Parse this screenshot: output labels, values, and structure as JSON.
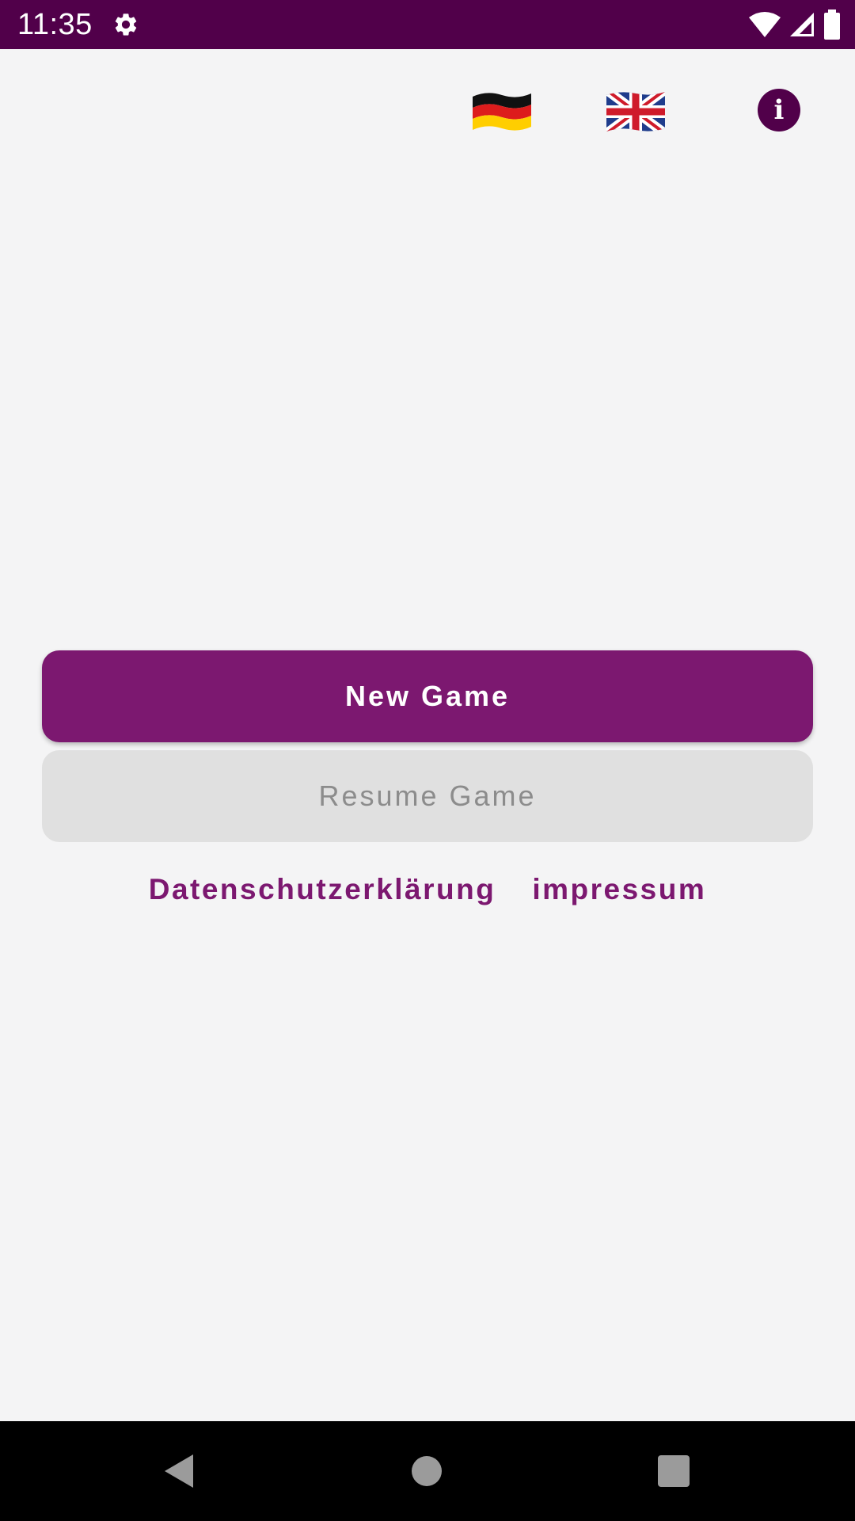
{
  "status_bar": {
    "time": "11:35",
    "icons": [
      "settings-icon",
      "wifi-icon",
      "signal-icon",
      "battery-icon"
    ],
    "background": "#51004a"
  },
  "toolbar": {
    "flags": [
      "german-flag-icon",
      "uk-flag-icon"
    ],
    "info_symbol": "i"
  },
  "actions": {
    "new_game_label": "New Game",
    "resume_game_label": "Resume Game",
    "resume_enabled": false
  },
  "links": {
    "privacy_label": "Datenschutzerklärung",
    "imprint_label": "impressum"
  },
  "colors": {
    "accent": "#7c1870",
    "dark_accent": "#51004a",
    "background": "#f4f4f5",
    "disabled_button": "#e0e0e0",
    "disabled_text": "#8c8c8c"
  },
  "nav_bar": {
    "buttons": [
      "back-icon",
      "home-icon",
      "recents-icon"
    ]
  }
}
